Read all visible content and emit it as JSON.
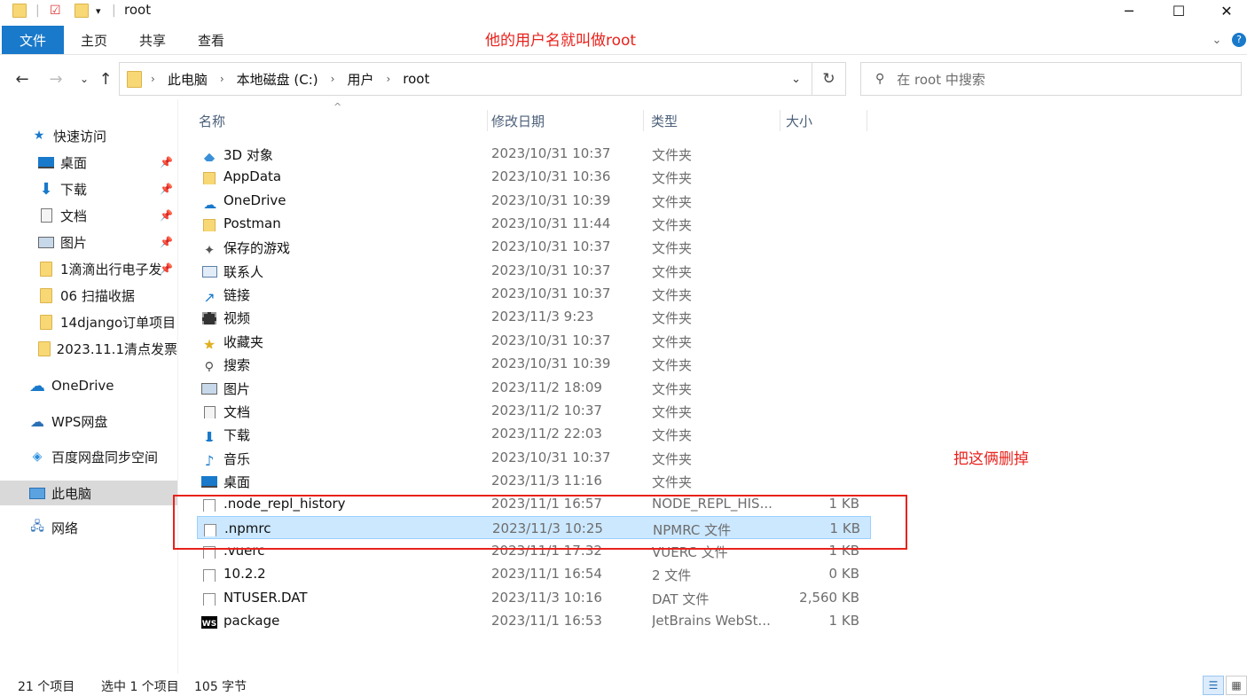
{
  "window": {
    "title": "root",
    "minimize": "─",
    "maximize": "☐",
    "close": "✕"
  },
  "ribbon": {
    "tabs": [
      "文件",
      "主页",
      "共享",
      "查看"
    ]
  },
  "annotations": {
    "username_note": "他的用户名就叫做root",
    "delete_note": "把这俩删掉"
  },
  "address": {
    "crumbs": [
      "此电脑",
      "本地磁盘 (C:)",
      "用户",
      "root"
    ],
    "search_placeholder": "在 root 中搜索"
  },
  "sidebar": {
    "quick_access": "快速访问",
    "items": [
      {
        "label": "桌面",
        "icon": "desktop-icon",
        "pinned": true
      },
      {
        "label": "下载",
        "icon": "download-icon",
        "pinned": true
      },
      {
        "label": "文档",
        "icon": "document-icon",
        "pinned": true
      },
      {
        "label": "图片",
        "icon": "picture-icon",
        "pinned": true
      },
      {
        "label": "1滴滴出行电子发",
        "icon": "folder-icon",
        "pinned": true
      },
      {
        "label": "06 扫描收据",
        "icon": "folder-icon",
        "pinned": false
      },
      {
        "label": "14django订单项目",
        "icon": "folder-icon",
        "pinned": false
      },
      {
        "label": "2023.11.1清点发票",
        "icon": "folder-icon",
        "pinned": false
      }
    ],
    "onedrive": "OneDrive",
    "wps": "WPS网盘",
    "baidu": "百度网盘同步空间",
    "thispc": "此电脑",
    "network": "网络"
  },
  "columns": {
    "name": "名称",
    "date": "修改日期",
    "type": "类型",
    "size": "大小"
  },
  "files": [
    {
      "name": "3D 对象",
      "date": "2023/10/31 10:37",
      "type": "文件夹",
      "size": "",
      "icon": "3d-objects-icon"
    },
    {
      "name": "AppData",
      "date": "2023/10/31 10:36",
      "type": "文件夹",
      "size": "",
      "icon": "folder-icon"
    },
    {
      "name": "OneDrive",
      "date": "2023/10/31 10:39",
      "type": "文件夹",
      "size": "",
      "icon": "onedrive-icon"
    },
    {
      "name": "Postman",
      "date": "2023/10/31 11:44",
      "type": "文件夹",
      "size": "",
      "icon": "folder-icon"
    },
    {
      "name": "保存的游戏",
      "date": "2023/10/31 10:37",
      "type": "文件夹",
      "size": "",
      "icon": "saved-games-icon"
    },
    {
      "name": "联系人",
      "date": "2023/10/31 10:37",
      "type": "文件夹",
      "size": "",
      "icon": "contacts-icon"
    },
    {
      "name": "链接",
      "date": "2023/10/31 10:37",
      "type": "文件夹",
      "size": "",
      "icon": "links-icon"
    },
    {
      "name": "视频",
      "date": "2023/11/3 9:23",
      "type": "文件夹",
      "size": "",
      "icon": "video-icon"
    },
    {
      "name": "收藏夹",
      "date": "2023/10/31 10:37",
      "type": "文件夹",
      "size": "",
      "icon": "favorites-icon"
    },
    {
      "name": "搜索",
      "date": "2023/10/31 10:39",
      "type": "文件夹",
      "size": "",
      "icon": "search-icon"
    },
    {
      "name": "图片",
      "date": "2023/11/2 18:09",
      "type": "文件夹",
      "size": "",
      "icon": "picture-icon"
    },
    {
      "name": "文档",
      "date": "2023/11/2 10:37",
      "type": "文件夹",
      "size": "",
      "icon": "document-icon"
    },
    {
      "name": "下载",
      "date": "2023/11/2 22:03",
      "type": "文件夹",
      "size": "",
      "icon": "download-icon"
    },
    {
      "name": "音乐",
      "date": "2023/10/31 10:37",
      "type": "文件夹",
      "size": "",
      "icon": "music-icon"
    },
    {
      "name": "桌面",
      "date": "2023/11/3 11:16",
      "type": "文件夹",
      "size": "",
      "icon": "desktop-icon"
    },
    {
      "name": ".node_repl_history",
      "date": "2023/11/1 16:57",
      "type": "NODE_REPL_HIS...",
      "size": "1 KB",
      "icon": "file-icon"
    },
    {
      "name": ".npmrc",
      "date": "2023/11/3 10:25",
      "type": "NPMRC 文件",
      "size": "1 KB",
      "icon": "file-icon",
      "selected": true
    },
    {
      "name": ".vuerc",
      "date": "2023/11/1 17:32",
      "type": "VUERC 文件",
      "size": "1 KB",
      "icon": "file-icon"
    },
    {
      "name": "10.2.2",
      "date": "2023/11/1 16:54",
      "type": "2 文件",
      "size": "0 KB",
      "icon": "file-icon"
    },
    {
      "name": "NTUSER.DAT",
      "date": "2023/11/3 10:16",
      "type": "DAT 文件",
      "size": "2,560 KB",
      "icon": "file-icon"
    },
    {
      "name": "package",
      "date": "2023/11/1 16:53",
      "type": "JetBrains WebSt...",
      "size": "1 KB",
      "icon": "webstorm-icon"
    }
  ],
  "status": {
    "count": "21 个项目",
    "selection": "选中 1 个项目",
    "bytes": "105 字节"
  }
}
